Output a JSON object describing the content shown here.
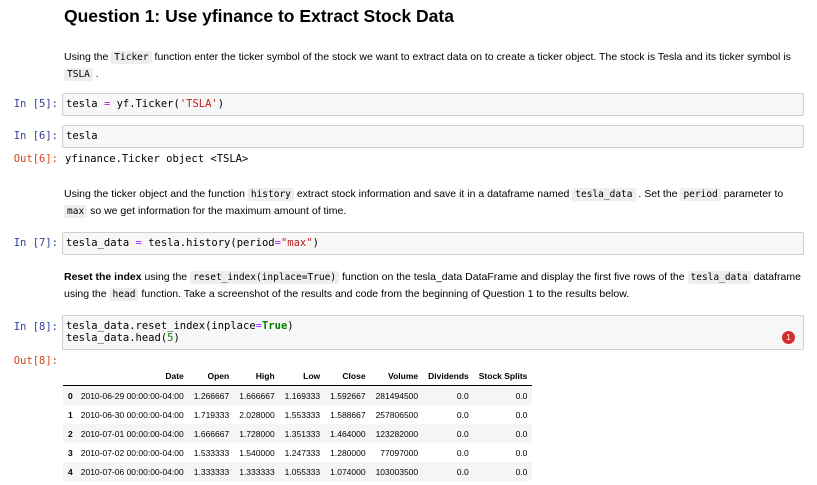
{
  "title": "Question 1: Use yfinance to Extract Stock Data",
  "md1": {
    "t1": "Using the ",
    "c1": "Ticker",
    "t2": " function enter the ticker symbol of the stock we want to extract data on to create a ticker object. The stock is Tesla and its ticker symbol is ",
    "c2": "TSLA",
    "t3": " ."
  },
  "cell5": {
    "prompt": "In [5]:",
    "var": "tesla",
    "op": "=",
    "call": "yf.Ticker(",
    "str": "'TSLA'",
    "close": ")"
  },
  "cell6": {
    "prompt": "In [6]:",
    "code": "tesla",
    "out_prompt": "Out[6]:",
    "output": "yfinance.Ticker object <TSLA>"
  },
  "md2": {
    "t1": "Using the ticker object and the function ",
    "c1": "history",
    "t2": " extract stock information and save it in a dataframe named ",
    "c2": "tesla_data",
    "t3": " . Set the ",
    "c3": "period",
    "t4": " parameter to ",
    "c4": "max",
    "t5": " so we get information for the maximum amount of time."
  },
  "cell7": {
    "prompt": "In [7]:",
    "var": "tesla_data",
    "op": "=",
    "call": "tesla.history(period",
    "op2": "=",
    "str": "\"max\"",
    "close": ")"
  },
  "md3": {
    "b1": "Reset the index",
    "t1": " using the ",
    "c1": "reset_index(inplace=True)",
    "t2": " function on the tesla_data DataFrame and display the first five rows of the ",
    "c2": "tesla_data",
    "t3": " dataframe using the ",
    "c3": "head",
    "t4": " function. Take a screenshot of the results and code from the beginning of Question 1 to the results below."
  },
  "cell8": {
    "prompt": "In [8]:",
    "line1_a": "tesla_data.reset_index(inplace",
    "line1_op": "=",
    "line1_kw": "True",
    "line1_close": ")",
    "line2_a": "tesla_data.head(",
    "line2_num": "5",
    "line2_close": ")",
    "badge": "1",
    "out_prompt": "Out[8]:"
  },
  "table": {
    "columns": [
      "",
      "Date",
      "Open",
      "High",
      "Low",
      "Close",
      "Volume",
      "Dividends",
      "Stock Splits"
    ],
    "rows": [
      [
        "0",
        "2010-06-29 00:00:00-04:00",
        "1.266667",
        "1.666667",
        "1.169333",
        "1.592667",
        "281494500",
        "0.0",
        "0.0"
      ],
      [
        "1",
        "2010-06-30 00:00:00-04:00",
        "1.719333",
        "2.028000",
        "1.553333",
        "1.588667",
        "257806500",
        "0.0",
        "0.0"
      ],
      [
        "2",
        "2010-07-01 00:00:00-04:00",
        "1.666667",
        "1.728000",
        "1.351333",
        "1.464000",
        "123282000",
        "0.0",
        "0.0"
      ],
      [
        "3",
        "2010-07-02 00:00:00-04:00",
        "1.533333",
        "1.540000",
        "1.247333",
        "1.280000",
        "77097000",
        "0.0",
        "0.0"
      ],
      [
        "4",
        "2010-07-06 00:00:00-04:00",
        "1.333333",
        "1.333333",
        "1.055333",
        "1.074000",
        "103003500",
        "0.0",
        "0.0"
      ]
    ]
  }
}
